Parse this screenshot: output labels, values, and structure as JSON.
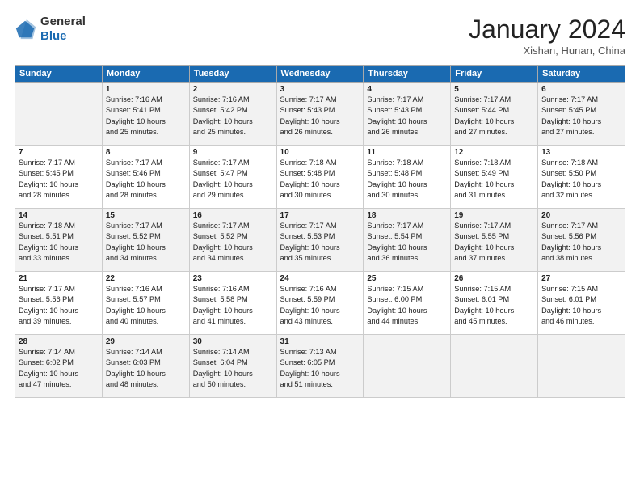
{
  "header": {
    "logo_line1": "General",
    "logo_line2": "Blue",
    "month": "January 2024",
    "location": "Xishan, Hunan, China"
  },
  "weekdays": [
    "Sunday",
    "Monday",
    "Tuesday",
    "Wednesday",
    "Thursday",
    "Friday",
    "Saturday"
  ],
  "weeks": [
    [
      {
        "day": "",
        "info": ""
      },
      {
        "day": "1",
        "info": "Sunrise: 7:16 AM\nSunset: 5:41 PM\nDaylight: 10 hours\nand 25 minutes."
      },
      {
        "day": "2",
        "info": "Sunrise: 7:16 AM\nSunset: 5:42 PM\nDaylight: 10 hours\nand 25 minutes."
      },
      {
        "day": "3",
        "info": "Sunrise: 7:17 AM\nSunset: 5:43 PM\nDaylight: 10 hours\nand 26 minutes."
      },
      {
        "day": "4",
        "info": "Sunrise: 7:17 AM\nSunset: 5:43 PM\nDaylight: 10 hours\nand 26 minutes."
      },
      {
        "day": "5",
        "info": "Sunrise: 7:17 AM\nSunset: 5:44 PM\nDaylight: 10 hours\nand 27 minutes."
      },
      {
        "day": "6",
        "info": "Sunrise: 7:17 AM\nSunset: 5:45 PM\nDaylight: 10 hours\nand 27 minutes."
      }
    ],
    [
      {
        "day": "7",
        "info": "Sunrise: 7:17 AM\nSunset: 5:45 PM\nDaylight: 10 hours\nand 28 minutes."
      },
      {
        "day": "8",
        "info": "Sunrise: 7:17 AM\nSunset: 5:46 PM\nDaylight: 10 hours\nand 28 minutes."
      },
      {
        "day": "9",
        "info": "Sunrise: 7:17 AM\nSunset: 5:47 PM\nDaylight: 10 hours\nand 29 minutes."
      },
      {
        "day": "10",
        "info": "Sunrise: 7:18 AM\nSunset: 5:48 PM\nDaylight: 10 hours\nand 30 minutes."
      },
      {
        "day": "11",
        "info": "Sunrise: 7:18 AM\nSunset: 5:48 PM\nDaylight: 10 hours\nand 30 minutes."
      },
      {
        "day": "12",
        "info": "Sunrise: 7:18 AM\nSunset: 5:49 PM\nDaylight: 10 hours\nand 31 minutes."
      },
      {
        "day": "13",
        "info": "Sunrise: 7:18 AM\nSunset: 5:50 PM\nDaylight: 10 hours\nand 32 minutes."
      }
    ],
    [
      {
        "day": "14",
        "info": "Sunrise: 7:18 AM\nSunset: 5:51 PM\nDaylight: 10 hours\nand 33 minutes."
      },
      {
        "day": "15",
        "info": "Sunrise: 7:17 AM\nSunset: 5:52 PM\nDaylight: 10 hours\nand 34 minutes."
      },
      {
        "day": "16",
        "info": "Sunrise: 7:17 AM\nSunset: 5:52 PM\nDaylight: 10 hours\nand 34 minutes."
      },
      {
        "day": "17",
        "info": "Sunrise: 7:17 AM\nSunset: 5:53 PM\nDaylight: 10 hours\nand 35 minutes."
      },
      {
        "day": "18",
        "info": "Sunrise: 7:17 AM\nSunset: 5:54 PM\nDaylight: 10 hours\nand 36 minutes."
      },
      {
        "day": "19",
        "info": "Sunrise: 7:17 AM\nSunset: 5:55 PM\nDaylight: 10 hours\nand 37 minutes."
      },
      {
        "day": "20",
        "info": "Sunrise: 7:17 AM\nSunset: 5:56 PM\nDaylight: 10 hours\nand 38 minutes."
      }
    ],
    [
      {
        "day": "21",
        "info": "Sunrise: 7:17 AM\nSunset: 5:56 PM\nDaylight: 10 hours\nand 39 minutes."
      },
      {
        "day": "22",
        "info": "Sunrise: 7:16 AM\nSunset: 5:57 PM\nDaylight: 10 hours\nand 40 minutes."
      },
      {
        "day": "23",
        "info": "Sunrise: 7:16 AM\nSunset: 5:58 PM\nDaylight: 10 hours\nand 41 minutes."
      },
      {
        "day": "24",
        "info": "Sunrise: 7:16 AM\nSunset: 5:59 PM\nDaylight: 10 hours\nand 43 minutes."
      },
      {
        "day": "25",
        "info": "Sunrise: 7:15 AM\nSunset: 6:00 PM\nDaylight: 10 hours\nand 44 minutes."
      },
      {
        "day": "26",
        "info": "Sunrise: 7:15 AM\nSunset: 6:01 PM\nDaylight: 10 hours\nand 45 minutes."
      },
      {
        "day": "27",
        "info": "Sunrise: 7:15 AM\nSunset: 6:01 PM\nDaylight: 10 hours\nand 46 minutes."
      }
    ],
    [
      {
        "day": "28",
        "info": "Sunrise: 7:14 AM\nSunset: 6:02 PM\nDaylight: 10 hours\nand 47 minutes."
      },
      {
        "day": "29",
        "info": "Sunrise: 7:14 AM\nSunset: 6:03 PM\nDaylight: 10 hours\nand 48 minutes."
      },
      {
        "day": "30",
        "info": "Sunrise: 7:14 AM\nSunset: 6:04 PM\nDaylight: 10 hours\nand 50 minutes."
      },
      {
        "day": "31",
        "info": "Sunrise: 7:13 AM\nSunset: 6:05 PM\nDaylight: 10 hours\nand 51 minutes."
      },
      {
        "day": "",
        "info": ""
      },
      {
        "day": "",
        "info": ""
      },
      {
        "day": "",
        "info": ""
      }
    ]
  ]
}
